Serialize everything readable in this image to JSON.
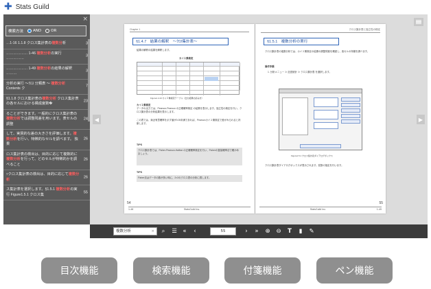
{
  "app": {
    "title": "Stats Guild"
  },
  "sidebar": {
    "close_label": "×",
    "search_options": {
      "label": "検索方法",
      "option_and": "AND",
      "option_or": "OR"
    },
    "items": [
      {
        "pre": "…1-16 1.1.8 クロス集計表の",
        "hl": "複数分",
        "post": "析",
        "num": "3"
      },
      {
        "pre": "……………… 1-46 ",
        "hl": "複数分析",
        "post": "の実行 ……………",
        "num": "3"
      },
      {
        "pre": "……………… 1-49 ",
        "hl": "複数分析",
        "post": "の結果の解釈 ………",
        "num": "3"
      },
      {
        "pre": "分析の実行 ～ｸﾛｽ 分類表 ～ ",
        "hl": "複数分析",
        "post": " Contents ク",
        "num": "7"
      },
      {
        "pre": "§1.1.8 クロス集計表の",
        "hl": "複数分析",
        "post": " クロス集計表の各セルにおける構成度数�",
        "num": "23"
      },
      {
        "pre": "ることができます。一般的にクロス集計表の",
        "hl": "複数分析",
        "post": "では調整残差を用います。表セルの調整",
        "num": "24"
      },
      {
        "pre": "して、実質的な差の大きさを評価します。",
        "hl": "複数分析",
        "post": "を行い、特徴的なセルを調べます。 独果",
        "num": "26"
      },
      {
        "pre": "ロス集計表の検出は、目的に応じて複数的に",
        "hl": "複数分析",
        "post": "を行って、どのセルが特徴的かを調べること",
        "num": "26"
      },
      {
        "pre": "ｯクロス集計表の検出は、目的に応じて",
        "hl": "複数分析",
        "post": "",
        "num": "26"
      },
      {
        "pre": "ス集計表を選択します。§1.5.1 ",
        "hl": "複数分析",
        "post": "の実行 Figure1.5.1 クロス集",
        "num": "55"
      }
    ]
  },
  "left_page": {
    "header_left": "Chapter 1",
    "section_title": "§1.4.7　結果の解釈　～ｸﾛｽ集計表～",
    "intro": "結果の解釈の結果を解釈します。",
    "table_title": "カイ２乗検定",
    "fig_caption": "Figure1.4.13 カイ２乗検定テーブル（出力結果の読み方）",
    "body_bold": "カイ２乗検定",
    "body_text": "データの出力では、Pearson-Pearson の正確確率検定 の結果を表示します。独立性の検定を行い、クロス集計表の分析結果を表示します。",
    "body_text2": "この表では、漸近有意確率を示す値が0.05未満であれば、Pearsonカイ２乗検定で差がみられると判断します。",
    "tips_1": "TIPS",
    "tips_text_1": "クロス集計表では、Fisher-Pearson-Hallton の正確確率検定を行い、Fisherの直接確率法で確かめましょう。",
    "tips_2": "TIPS",
    "tips_text_2": "Fisher法はデータの数が多い時に、2×2のクロス表の分析に適します。",
    "footer_left": "1-48",
    "footer_center": "StatsGuild Inc.",
    "page_no": "54"
  },
  "right_page": {
    "header_right": "クロス集計表と独立性の検定",
    "section_title": "§1.5.1　複数分析の実行",
    "intro": "クロス集計表の複数分析では、カイ２乗検定の結果の調整残差を確認し、各セルの特徴を調べます。",
    "step_title": "操作手順",
    "step_1": "1. 分析メニュー ≫ 記述統計 ≫ クロス集計表 を選択します。",
    "fig_caption": "Figure1.5.1 クロス集計表ダイアログボックス",
    "body_text": "クロス集計表ダイアログボックスが表示されます。変数の指定を行います。",
    "footer_center": "StatsGuild Inc.",
    "footer_right": "1-49",
    "page_no": "55"
  },
  "toolbar": {
    "search_value": "複数分析",
    "search_clear": "×",
    "page_value": "55",
    "icons": [
      "search-icon",
      "list-icon",
      "first-page-icon",
      "prev-page-icon",
      "next-page-icon",
      "last-page-icon",
      "zoom-in-icon",
      "zoom-out-icon",
      "text-icon",
      "bookmark-icon",
      "pen-icon"
    ]
  },
  "features": {
    "toc": "目次機能",
    "search": "検索機能",
    "sticky": "付箋機能",
    "pen": "ペン機能"
  },
  "colors": {
    "accent": "#2e64b8",
    "highlight": "#ff5e5e",
    "sidebar_bg": "#5a5a5a",
    "toolbar_bg": "#3b3b3b",
    "button_bg": "#8f8f8f"
  }
}
